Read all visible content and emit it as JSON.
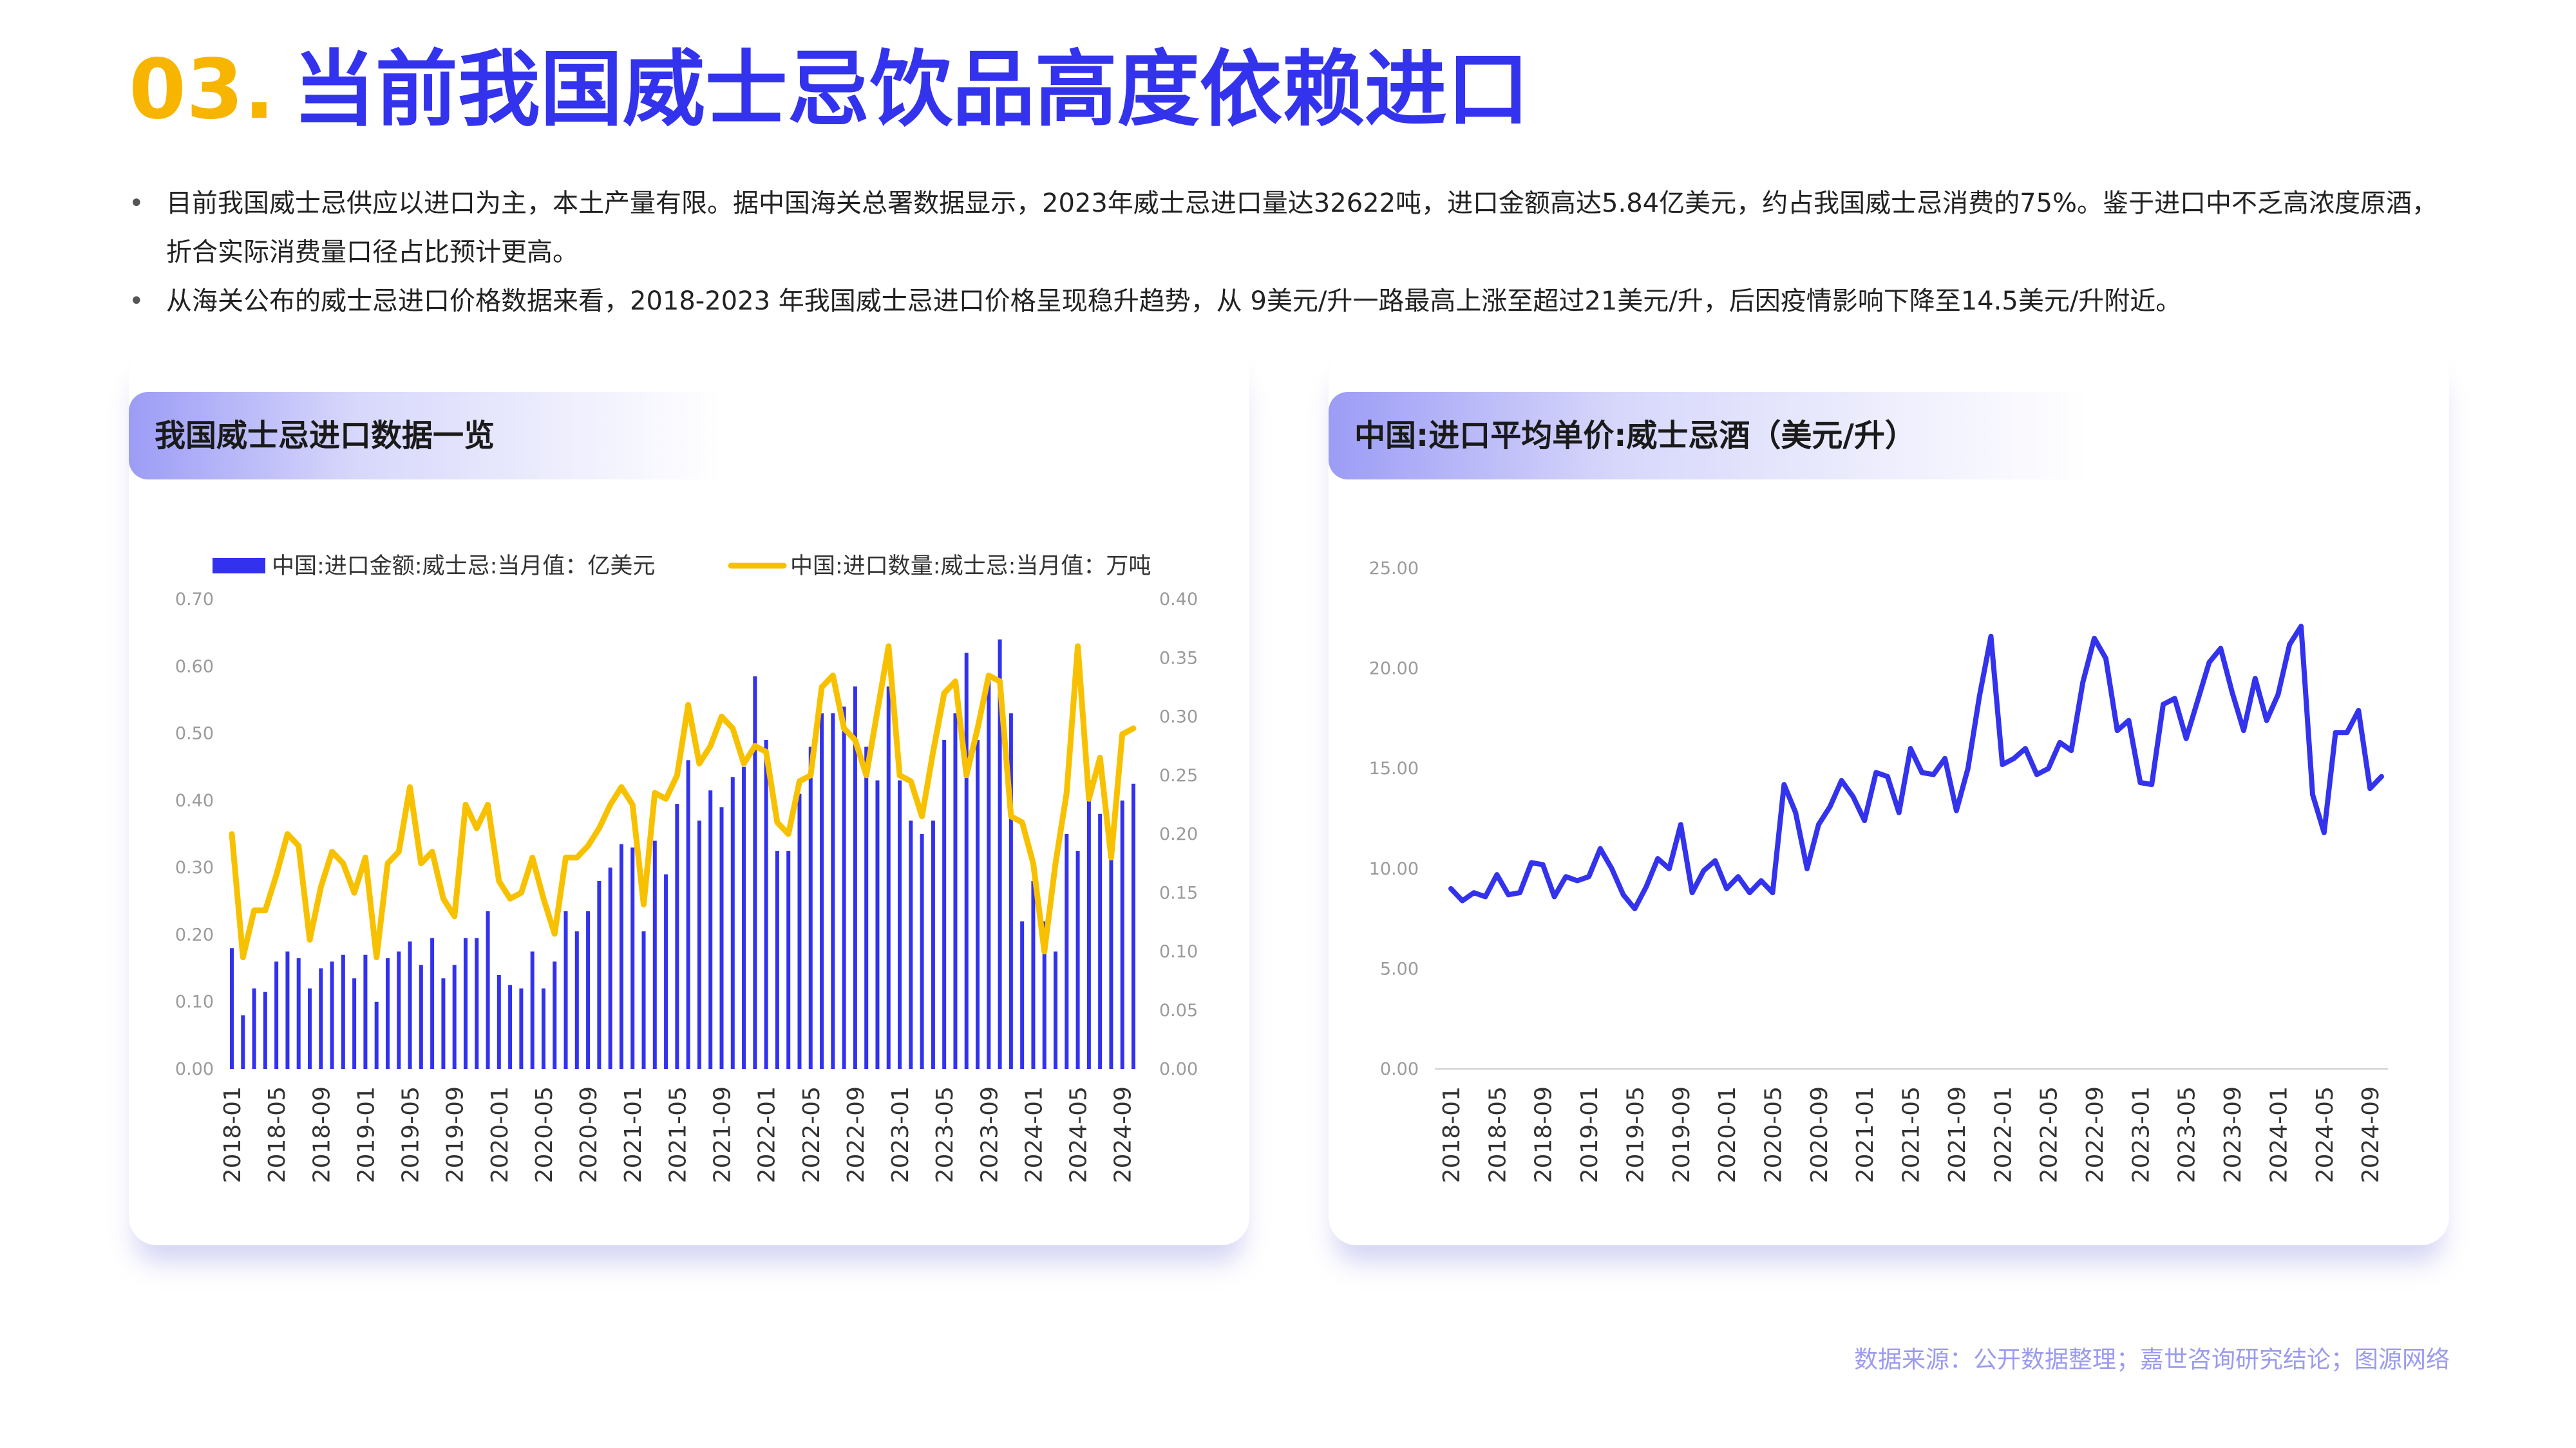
{
  "header": {
    "number": "03.",
    "title": "当前我国威士忌饮品高度依赖进口"
  },
  "bullets": [
    "目前我国威士忌供应以进口为主，本土产量有限。据中国海关总署数据显示，2023年威士忌进口量达32622吨，进口金额高达5.84亿美元，约占我国威士忌消费的75%。鉴于进口中不乏高浓度原酒，折合实际消费量口径占比预计更高。",
    "从海关公布的威士忌进口价格数据来看，2018-2023 年我国威士忌进口价格呈现稳升趋势，从 9美元/升一路最高上涨至超过21美元/升，后因疫情影响下降至14.5美元/升附近。"
  ],
  "colors": {
    "accent_yellow": "#F7B500",
    "accent_blue": "#3333EE",
    "bar": "#3232EE",
    "line": "#F8C100",
    "source": "#9b9bf0"
  },
  "source_text": "数据来源：公开数据整理；嘉世咨询研究结论；图源网络",
  "chart_data": [
    {
      "type": "bar",
      "card_title": "我国威士忌进口数据一览",
      "x_start": "2018-01",
      "x_tick_labels": [
        "2018-01",
        "2018-05",
        "2018-09",
        "2019-01",
        "2019-05",
        "2019-09",
        "2020-01",
        "2020-05",
        "2020-09",
        "2021-01",
        "2021-05",
        "2021-09",
        "2022-01",
        "2022-05",
        "2022-09",
        "2023-01",
        "2023-05",
        "2023-09",
        "2024-01",
        "2024-05",
        "2024-09"
      ],
      "ylim_left": [
        0,
        0.7
      ],
      "yticks_left": [
        "0.00",
        "0.10",
        "0.20",
        "0.30",
        "0.40",
        "0.50",
        "0.60",
        "0.70"
      ],
      "ylim_right": [
        0,
        0.4
      ],
      "yticks_right": [
        "0.00",
        "0.05",
        "0.10",
        "0.15",
        "0.20",
        "0.25",
        "0.30",
        "0.35",
        "0.40"
      ],
      "legend": "top",
      "series": [
        {
          "name": "中国:进口金额:威士忌:当月值：亿美元",
          "type": "bar",
          "axis": "left",
          "values": [
            0.18,
            0.08,
            0.12,
            0.115,
            0.16,
            0.175,
            0.165,
            0.12,
            0.15,
            0.16,
            0.17,
            0.135,
            0.17,
            0.1,
            0.165,
            0.175,
            0.19,
            0.155,
            0.195,
            0.135,
            0.155,
            0.195,
            0.195,
            0.235,
            0.14,
            0.125,
            0.12,
            0.175,
            0.12,
            0.16,
            0.235,
            0.205,
            0.235,
            0.28,
            0.3,
            0.335,
            0.33,
            0.205,
            0.34,
            0.29,
            0.395,
            0.46,
            0.37,
            0.415,
            0.39,
            0.435,
            0.45,
            0.585,
            0.49,
            0.325,
            0.325,
            0.41,
            0.48,
            0.53,
            0.53,
            0.54,
            0.57,
            0.48,
            0.43,
            0.57,
            0.43,
            0.37,
            0.35,
            0.37,
            0.49,
            0.53,
            0.62,
            0.49,
            0.58,
            0.64,
            0.53,
            0.22,
            0.28,
            0.22,
            0.175,
            0.35,
            0.325,
            0.43,
            0.38,
            0.32,
            0.4,
            0.425
          ]
        },
        {
          "name": "中国:进口数量:威士忌:当月值：万吨",
          "type": "line",
          "axis": "right",
          "values": [
            0.2,
            0.095,
            0.135,
            0.135,
            0.165,
            0.2,
            0.19,
            0.11,
            0.155,
            0.185,
            0.175,
            0.15,
            0.18,
            0.095,
            0.175,
            0.185,
            0.24,
            0.175,
            0.185,
            0.145,
            0.13,
            0.225,
            0.205,
            0.225,
            0.16,
            0.145,
            0.15,
            0.18,
            0.145,
            0.115,
            0.18,
            0.18,
            0.19,
            0.205,
            0.225,
            0.24,
            0.225,
            0.14,
            0.235,
            0.23,
            0.25,
            0.31,
            0.26,
            0.275,
            0.3,
            0.29,
            0.26,
            0.275,
            0.27,
            0.21,
            0.2,
            0.245,
            0.25,
            0.325,
            0.335,
            0.29,
            0.28,
            0.25,
            0.305,
            0.36,
            0.25,
            0.245,
            0.215,
            0.27,
            0.32,
            0.33,
            0.25,
            0.29,
            0.335,
            0.33,
            0.215,
            0.21,
            0.175,
            0.1,
            0.175,
            0.235,
            0.36,
            0.23,
            0.265,
            0.18,
            0.285,
            0.29
          ]
        }
      ]
    },
    {
      "type": "line",
      "card_title": "中国:进口平均单价:威士忌酒（美元/升）",
      "x_start": "2018-01",
      "x_tick_labels": [
        "2018-01",
        "2018-05",
        "2018-09",
        "2019-01",
        "2019-05",
        "2019-09",
        "2020-01",
        "2020-05",
        "2020-09",
        "2021-01",
        "2021-05",
        "2021-09",
        "2022-01",
        "2022-05",
        "2022-09",
        "2023-01",
        "2023-05",
        "2023-09",
        "2024-01",
        "2024-05",
        "2024-09"
      ],
      "ylim": [
        0,
        25
      ],
      "yticks": [
        "0.00",
        "5.00",
        "10.00",
        "15.00",
        "20.00",
        "25.00"
      ],
      "series": [
        {
          "values": [
            9.0,
            8.4,
            8.8,
            8.6,
            9.7,
            8.7,
            8.8,
            10.3,
            10.2,
            8.6,
            9.6,
            9.4,
            9.6,
            11.0,
            10.0,
            8.7,
            8.0,
            9.1,
            10.5,
            10.0,
            12.2,
            8.8,
            9.9,
            10.4,
            9.0,
            9.6,
            8.8,
            9.4,
            8.8,
            14.2,
            12.8,
            10.0,
            12.2,
            13.1,
            14.4,
            13.6,
            12.4,
            14.8,
            14.6,
            12.8,
            16.0,
            14.8,
            14.7,
            15.5,
            12.9,
            15.0,
            18.6,
            21.6,
            15.2,
            15.5,
            16.0,
            14.7,
            15.0,
            16.3,
            15.9,
            19.3,
            21.5,
            20.5,
            16.9,
            17.4,
            14.3,
            14.2,
            18.2,
            18.5,
            16.5,
            18.4,
            20.3,
            21.0,
            18.8,
            16.9,
            19.5,
            17.4,
            18.7,
            21.2,
            22.1,
            13.7,
            11.8,
            16.8,
            16.8,
            17.9,
            14.0,
            14.6
          ]
        }
      ]
    }
  ]
}
